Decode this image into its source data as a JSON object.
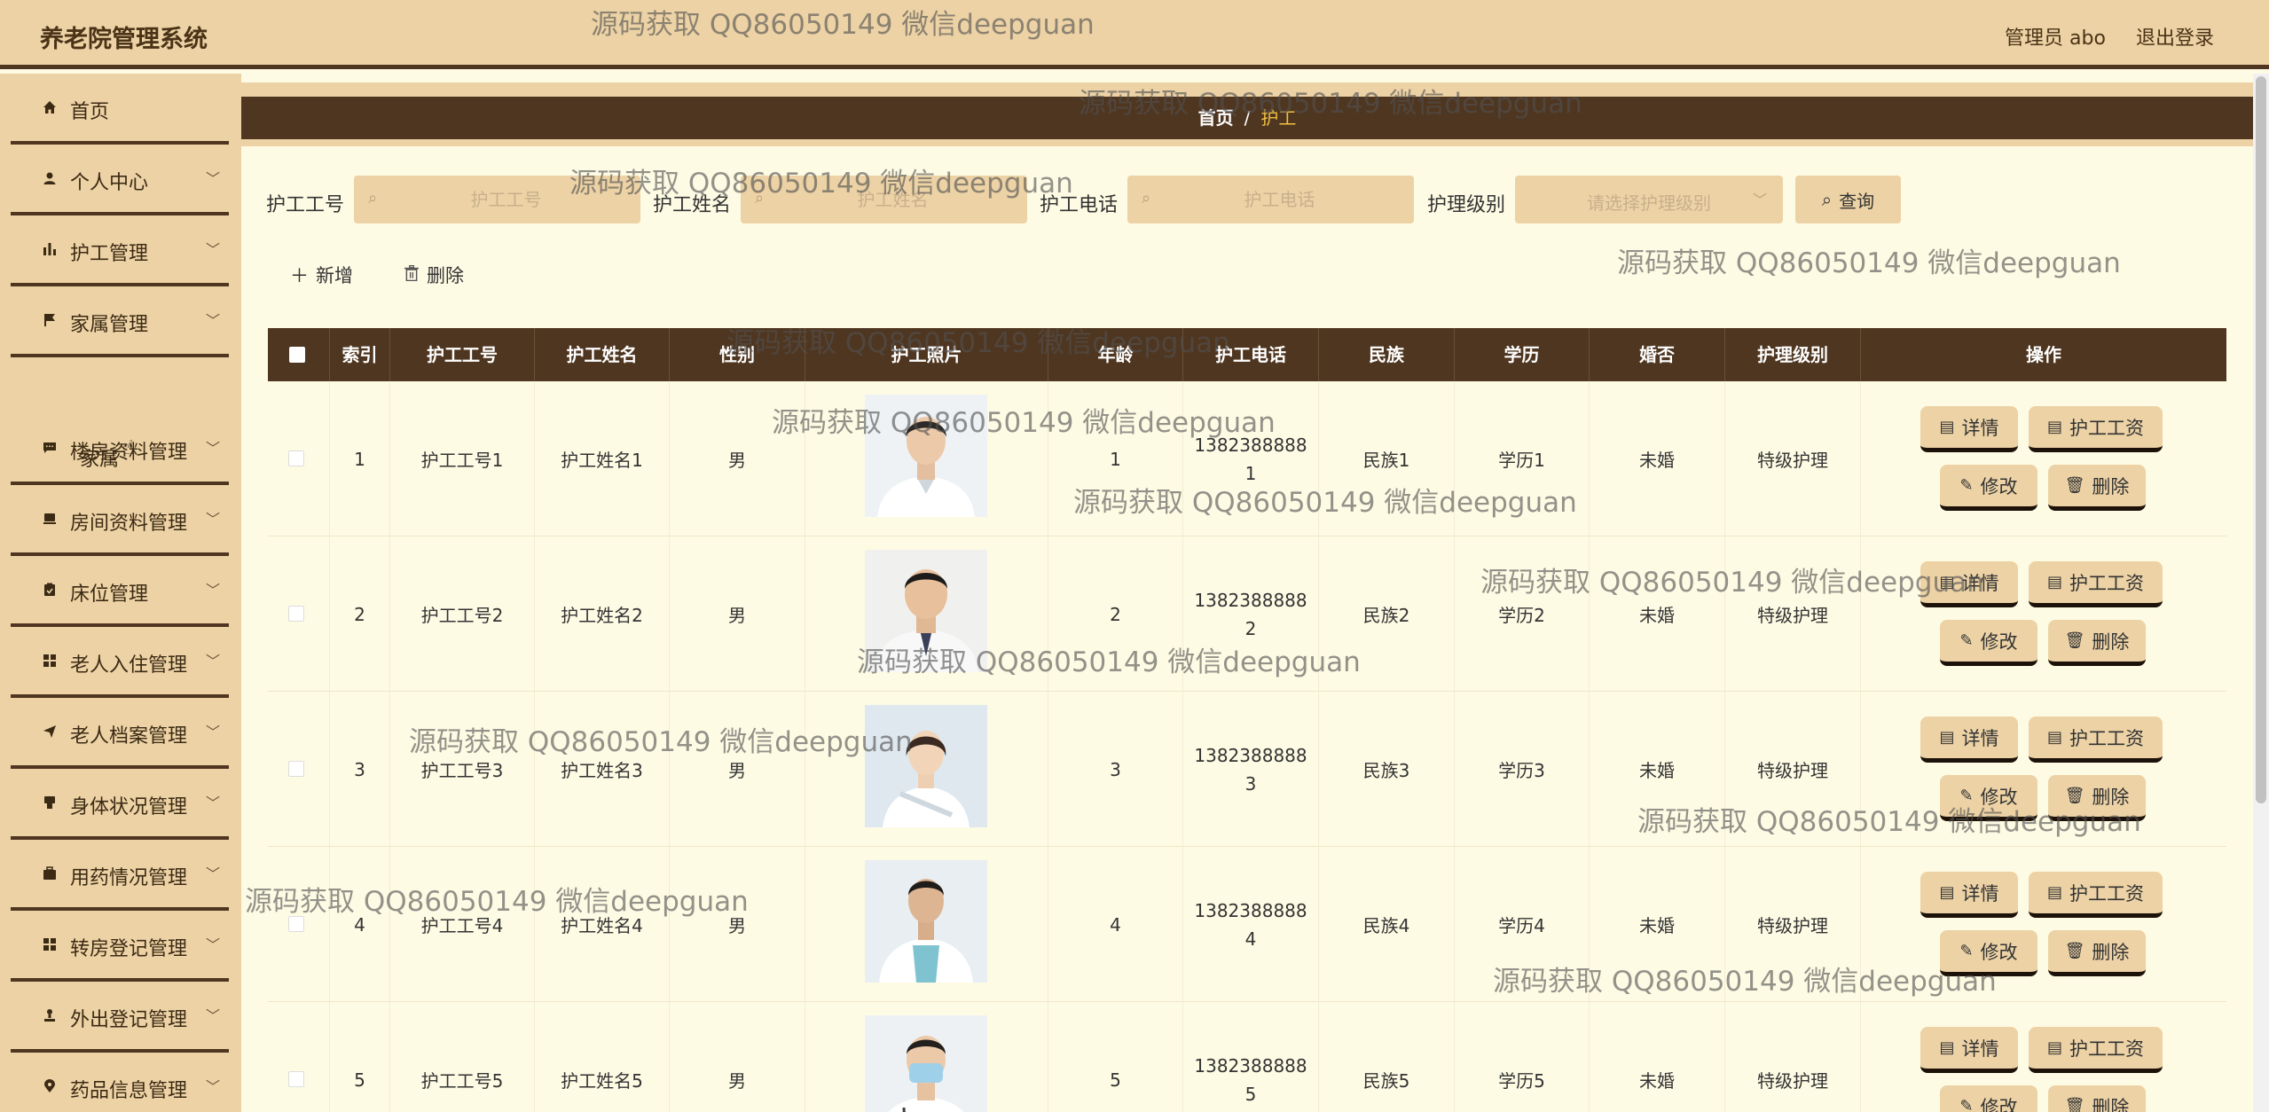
{
  "header": {
    "title": "养老院管理系统",
    "admin": "管理员 abo",
    "logout": "退出登录"
  },
  "sidebar": {
    "items": [
      {
        "label": "首页",
        "icon": "home-icon",
        "expandable": false
      },
      {
        "label": "个人中心",
        "icon": "user-icon",
        "expandable": true
      },
      {
        "label": "护工管理",
        "icon": "bar-chart-icon",
        "expandable": true
      },
      {
        "label": "家属管理",
        "icon": "flag-icon",
        "expandable": true
      },
      {
        "label": "楼房资料管理",
        "icon": "message-icon",
        "expandable": true
      },
      {
        "label": "房间资料管理",
        "icon": "door-icon",
        "expandable": true
      },
      {
        "label": "床位管理",
        "icon": "clipboard-icon",
        "expandable": true
      },
      {
        "label": "老人入住管理",
        "icon": "grid-icon",
        "expandable": true
      },
      {
        "label": "老人档案管理",
        "icon": "send-icon",
        "expandable": true
      },
      {
        "label": "身体状况管理",
        "icon": "phone-icon",
        "expandable": true
      },
      {
        "label": "用药情况管理",
        "icon": "suitcase-icon",
        "expandable": true
      },
      {
        "label": "转房登记管理",
        "icon": "grid-icon",
        "expandable": true
      },
      {
        "label": "外出登记管理",
        "icon": "person-icon",
        "expandable": true
      },
      {
        "label": "药品信息管理",
        "icon": "location-icon",
        "expandable": true
      }
    ],
    "sub_item": "家属"
  },
  "breadcrumb": {
    "home": "首页",
    "sep": "/",
    "current": "护工"
  },
  "filters": {
    "job_no": {
      "label": "护工工号",
      "placeholder": "护工工号"
    },
    "name": {
      "label": "护工姓名",
      "placeholder": "护工姓名"
    },
    "phone": {
      "label": "护工电话",
      "placeholder": "护工电话"
    },
    "level": {
      "label": "护理级别",
      "placeholder": "请选择护理级别"
    },
    "query": "查询"
  },
  "actions": {
    "add": "新增",
    "delete": "删除"
  },
  "table": {
    "headers": [
      "",
      "索引",
      "护工工号",
      "护工姓名",
      "性别",
      "护工照片",
      "年龄",
      "护工电话",
      "民族",
      "学历",
      "婚否",
      "护理级别",
      "操作"
    ],
    "rows": [
      {
        "index": "1",
        "job_no": "护工工号1",
        "name": "护工姓名1",
        "gender": "男",
        "age": "1",
        "phone_a": "1382388888",
        "phone_b": "1",
        "ethnicity": "民族1",
        "education": "学历1",
        "married": "未婚",
        "level": "特级护理"
      },
      {
        "index": "2",
        "job_no": "护工工号2",
        "name": "护工姓名2",
        "gender": "男",
        "age": "2",
        "phone_a": "1382388888",
        "phone_b": "2",
        "ethnicity": "民族2",
        "education": "学历2",
        "married": "未婚",
        "level": "特级护理"
      },
      {
        "index": "3",
        "job_no": "护工工号3",
        "name": "护工姓名3",
        "gender": "男",
        "age": "3",
        "phone_a": "1382388888",
        "phone_b": "3",
        "ethnicity": "民族3",
        "education": "学历3",
        "married": "未婚",
        "level": "特级护理"
      },
      {
        "index": "4",
        "job_no": "护工工号4",
        "name": "护工姓名4",
        "gender": "男",
        "age": "4",
        "phone_a": "1382388888",
        "phone_b": "4",
        "ethnicity": "民族4",
        "education": "学历4",
        "married": "未婚",
        "level": "特级护理"
      },
      {
        "index": "5",
        "job_no": "护工工号5",
        "name": "护工姓名5",
        "gender": "男",
        "age": "5",
        "phone_a": "1382388888",
        "phone_b": "5",
        "ethnicity": "民族5",
        "education": "学历5",
        "married": "未婚",
        "level": "特级护理"
      }
    ],
    "row_actions": {
      "detail": "详情",
      "salary": "护工工资",
      "edit": "修改",
      "delete": "删除"
    }
  },
  "watermark": "源码获取 QQ86050149 微信deepguan",
  "colors": {
    "header_bg": "#ecd2a5",
    "dark_brown": "#4f3620",
    "content_bg": "#fefbe4",
    "breadcrumb_active": "#f0c040"
  }
}
